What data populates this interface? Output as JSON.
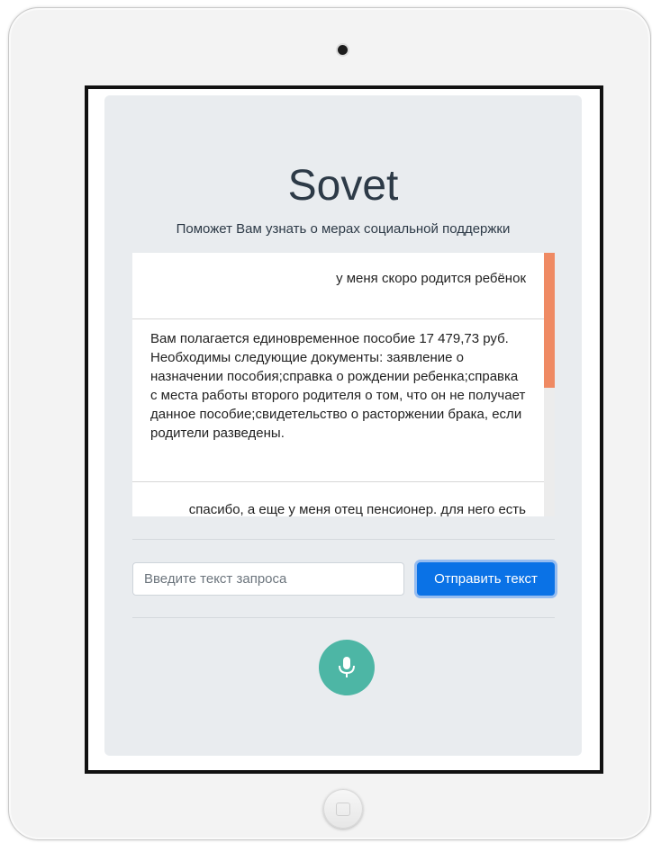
{
  "app": {
    "title": "Sovet",
    "subtitle": "Поможет Вам узнать о мерах социальной поддержки"
  },
  "chat": {
    "messages": [
      {
        "role": "user",
        "text": "у меня скоро родится ребёнок"
      },
      {
        "role": "bot",
        "text": "Вам полагается единовременное пособие 17 479,73 руб. Необходимы следующие документы: заявление о назначении пособия;справка о рождении ребенка;справка с места работы второго родителя о том, что он не получает данное пособие;свидетельство о расторжении брака, если родители разведены."
      },
      {
        "role": "user",
        "text": "спасибо, а еще у меня отец пенсионер. для него есть льготы"
      }
    ]
  },
  "input": {
    "placeholder": "Введите текст запроса",
    "value": ""
  },
  "send_button": {
    "label": "Отправить текст"
  },
  "mic_button": {
    "icon": "microphone-icon"
  },
  "colors": {
    "card_bg": "#e9ecef",
    "send_button": "#0a72e6",
    "mic_button": "#4db6a5",
    "scroll_thumb": "#ef8a63",
    "title": "#2d3a47"
  }
}
